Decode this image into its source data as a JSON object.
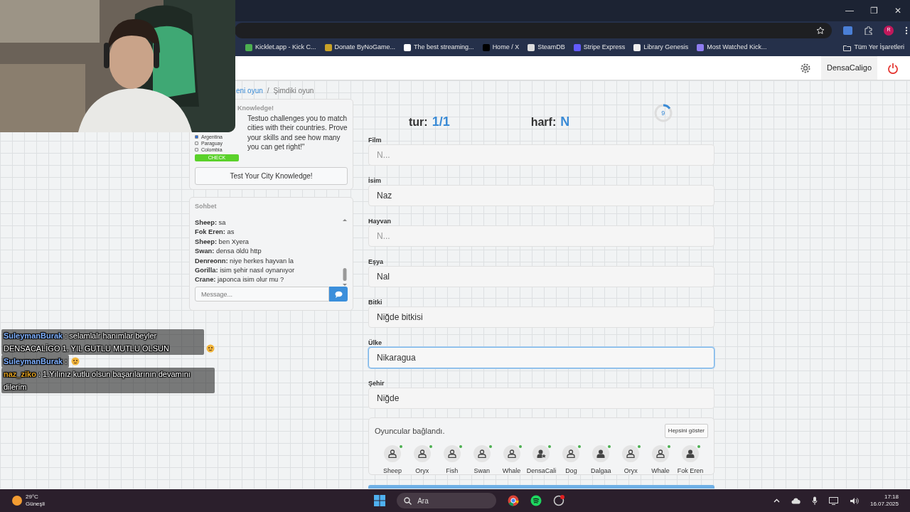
{
  "browser": {
    "window_controls": [
      "—",
      "❐",
      "✕"
    ],
    "profile_initial": "R",
    "bookmarks": [
      {
        "label": "Kicklet.app - Kick C...",
        "color": "#4caf50"
      },
      {
        "label": "Donate ByNoGame...",
        "color": "#c9a227"
      },
      {
        "label": "The best streaming...",
        "color": "#ffffff"
      },
      {
        "label": "Home / X",
        "color": "#000000"
      },
      {
        "label": "SteamDB",
        "color": "#dddddd"
      },
      {
        "label": "Stripe Express",
        "color": "#635bff"
      },
      {
        "label": "Library Genesis",
        "color": "#eeeeee"
      },
      {
        "label": "Most Watched Kick...",
        "color": "#8e7cf0"
      }
    ],
    "all_bookmarks": "Tüm Yer İşaretleri"
  },
  "header": {
    "username": "DensaCaligo"
  },
  "breadcrumb": {
    "items": [
      "eni oyun",
      "Şimdiki oyun"
    ],
    "separator": "/"
  },
  "ad": {
    "title": "Knowledge!",
    "options": [
      {
        "label": "Argentina",
        "checked": true
      },
      {
        "label": "Paraguay",
        "checked": false
      },
      {
        "label": "Colombia",
        "checked": false
      }
    ],
    "check_button": "CHECK",
    "text": "Testuo challenges you to match cities with their countries. Prove your skills and see how many you can get right!\"",
    "button": "Test Your City Knowledge!"
  },
  "chat": {
    "title": "Sohbet",
    "placeholder": "Message...",
    "messages": [
      {
        "user": "Sheep:",
        "text": "sa"
      },
      {
        "user": "Fok Eren:",
        "text": "as"
      },
      {
        "user": "Sheep:",
        "text": "ben Xyera"
      },
      {
        "user": "Swan:",
        "text": "densa öldü http"
      },
      {
        "user": "Denreonn:",
        "text": "niye herkes hayvan la"
      },
      {
        "user": "Gorilla:",
        "text": "isim şehir nasıl oynanıyor"
      },
      {
        "user": "Crane:",
        "text": "japonca isim olur mu ?"
      }
    ]
  },
  "game": {
    "round_label": "tur:",
    "round": "1/1",
    "letter_label": "harf:",
    "letter": "N",
    "timer": {
      "value": "9",
      "level": 0.15
    },
    "fields": [
      {
        "label": "Film",
        "placeholder": "N...",
        "focused": false
      },
      {
        "label": "İsim",
        "value": "Naz",
        "focused": false
      },
      {
        "label": "Hayvan",
        "placeholder": "N...",
        "focused": false
      },
      {
        "label": "Eşya",
        "value": "Nal",
        "focused": false
      },
      {
        "label": "Bitki",
        "value": "Niğde bitkisi",
        "focused": false
      },
      {
        "label": "Ülke",
        "value": "Nikaragua",
        "focused": true
      },
      {
        "label": "Şehir",
        "value": "Niğde",
        "focused": false
      }
    ]
  },
  "players": {
    "status": "Oyuncular bağlandı.",
    "show_all": "Hepsini göster",
    "list": [
      {
        "name": "Sheep",
        "kind": "outline",
        "online": true
      },
      {
        "name": "Oryx",
        "kind": "outline",
        "online": true
      },
      {
        "name": "Fish",
        "kind": "outline",
        "online": true
      },
      {
        "name": "Swan",
        "kind": "outline",
        "online": true
      },
      {
        "name": "Whale",
        "kind": "outline",
        "online": true
      },
      {
        "name": "DensaCali",
        "kind": "host",
        "online": true
      },
      {
        "name": "Dog",
        "kind": "outline",
        "online": true
      },
      {
        "name": "Dalgaa",
        "kind": "filled",
        "online": true
      },
      {
        "name": "Oryx",
        "kind": "outline",
        "online": true
      },
      {
        "name": "Whale",
        "kind": "outline",
        "online": true
      },
      {
        "name": "Fok Eren",
        "kind": "filled",
        "online": true
      }
    ]
  },
  "stream_chat": [
    {
      "user": "SuleymanBurak",
      "color": "#7fb0ff",
      "text": ": selamlalr hanımlar beyler DENSACALİGO 1. YIL GUTLU MUTLU OLSUN",
      "emoji": true
    },
    {
      "user": "SuleymanBurak",
      "color": "#7fb0ff",
      "text": ":",
      "emoji": true
    },
    {
      "user": "naz_ziko",
      "color": "#e0a020",
      "text": ": 1.Yılınız kutlu olsun başarılarının devamını dilerim",
      "emoji": false
    }
  ],
  "taskbar": {
    "temperature": "29°C",
    "weather": "Güneşli",
    "search": "Ara",
    "time": "17:18",
    "date": "16.07.2025"
  }
}
